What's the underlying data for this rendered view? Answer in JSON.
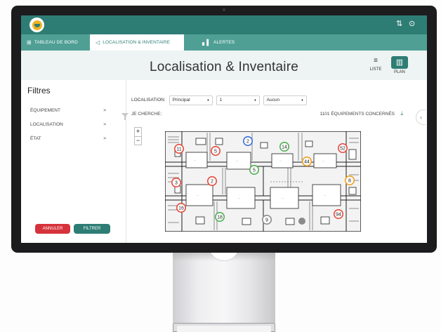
{
  "header": {
    "settings_icon": "sliders-icon",
    "user_icon": "user-icon",
    "brand_color": "#2e7d75"
  },
  "nav": {
    "tabs": [
      {
        "label": "TABLEAU DE BORD",
        "icon": "grid-icon",
        "active": false
      },
      {
        "label": "LOCALISATION & INVENTAIRE",
        "icon": "location-arrow-icon",
        "active": true
      },
      {
        "label": "ALERTES",
        "icon": "bar-chart-icon",
        "active": false
      }
    ]
  },
  "page": {
    "title": "Localisation & Inventaire",
    "views": [
      {
        "label": "LISTE",
        "icon": "list-icon",
        "active": false
      },
      {
        "label": "PLAN",
        "icon": "map-icon",
        "active": true
      }
    ]
  },
  "sidebar": {
    "title": "Filtres",
    "items": [
      {
        "label": "ÉQUIPEMENT",
        "chevron": ">"
      },
      {
        "label": "LOCALISATION",
        "chevron": ">"
      },
      {
        "label": "ÉTAT",
        "chevron": ">"
      }
    ],
    "cancel_label": "ANNULER",
    "filter_label": "FILTRER",
    "cancel_color": "#d6323c"
  },
  "filters": {
    "location_label": "LOCALISATION:",
    "site": "Principal",
    "floor": "1",
    "zone": "Aucun",
    "search_label": "JE CHERCHE:",
    "count_label": "1101 ÉQUIPEMENTS CONCERNÉS"
  },
  "map_controls": {
    "zoom_in": "+",
    "zoom_out": "−"
  },
  "floorplan": {
    "markers": [
      "11",
      "5",
      "2",
      "14",
      "52",
      "44",
      "5",
      "3",
      "2",
      "8",
      "16",
      "18",
      "9",
      "94"
    ]
  }
}
